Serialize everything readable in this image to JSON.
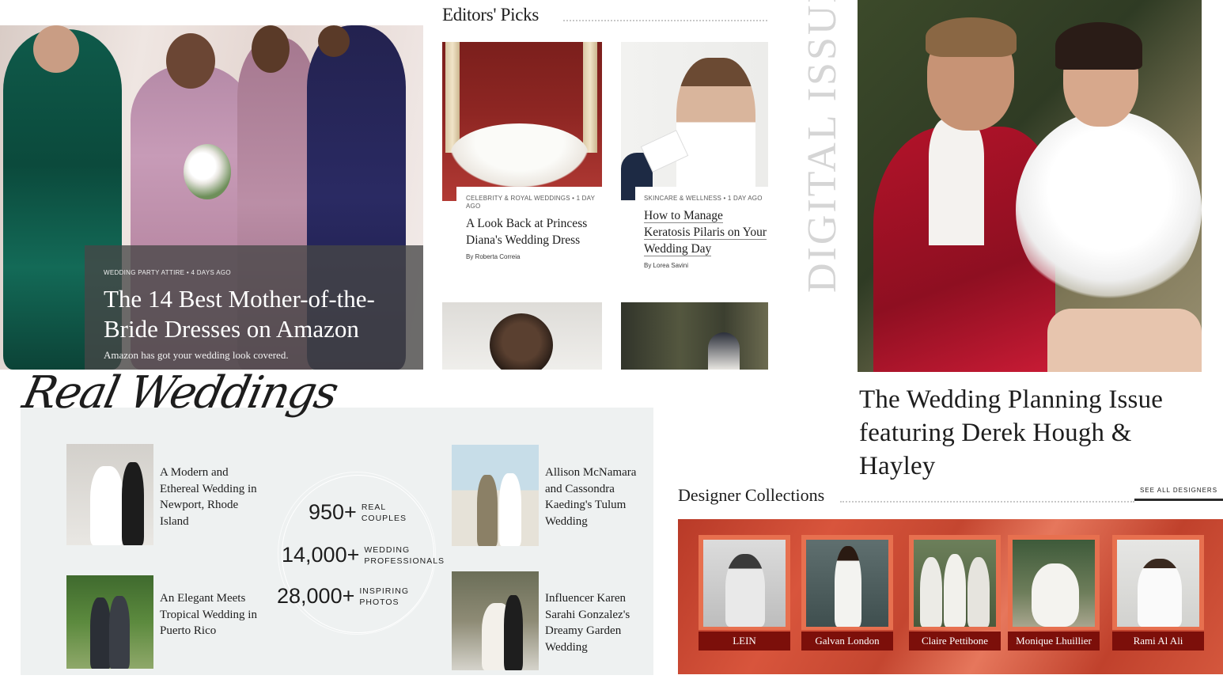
{
  "hero": {
    "kicker": "WEDDING PARTY ATTIRE • 4 DAYS AGO",
    "title": "The 14 Best Mother-of-the-Bride Dresses on Amazon",
    "subtitle": "Amazon has got your wedding look covered."
  },
  "editors_picks": {
    "title": "Editors' Picks",
    "cards": [
      {
        "kicker": "CELEBRITY & ROYAL WEDDINGS • 1 DAY AGO",
        "title": "A Look Back at Princess Diana's Wedding Dress",
        "byline": "By Roberta Correia"
      },
      {
        "kicker": "SKINCARE & WELLNESS • 1 DAY AGO",
        "title": "How to Manage Keratosis Pilaris on Your Wedding Day",
        "byline": "By Lorea Savini"
      }
    ]
  },
  "digital_issue": {
    "label": "DIGITAL ISSUE",
    "title": "The Wedding Planning Issue featuring Derek Hough & Hayley"
  },
  "real_weddings": {
    "script_title": "Real Weddings",
    "stories": [
      "A Modern and Ethereal Wedding in Newport, Rhode Island",
      "An Elegant Meets Tropical Wedding in Puerto Rico",
      "Allison McNamara and Cassondra Kaeding's Tulum Wedding",
      "Influencer Karen Sarahi Gonzalez's Dreamy Garden Wedding"
    ],
    "stats": [
      {
        "number": "950+",
        "label_line1": "REAL",
        "label_line2": "COUPLES"
      },
      {
        "number": "14,000+",
        "label_line1": "WEDDING",
        "label_line2": "PROFESSIONALS"
      },
      {
        "number": "28,000+",
        "label_line1": "INSPIRING",
        "label_line2": "PHOTOS"
      }
    ]
  },
  "designer_collections": {
    "title": "Designer Collections",
    "see_all": "SEE ALL DESIGNERS",
    "designers": [
      "LEIN",
      "Galvan London",
      "Claire Pettibone",
      "Monique Lhuillier",
      "Rami Al Ali"
    ]
  },
  "colors": {
    "designer_panel": "#c44630",
    "designer_label": "#7c0f0a",
    "real_weddings_panel": "#eef1f1"
  }
}
